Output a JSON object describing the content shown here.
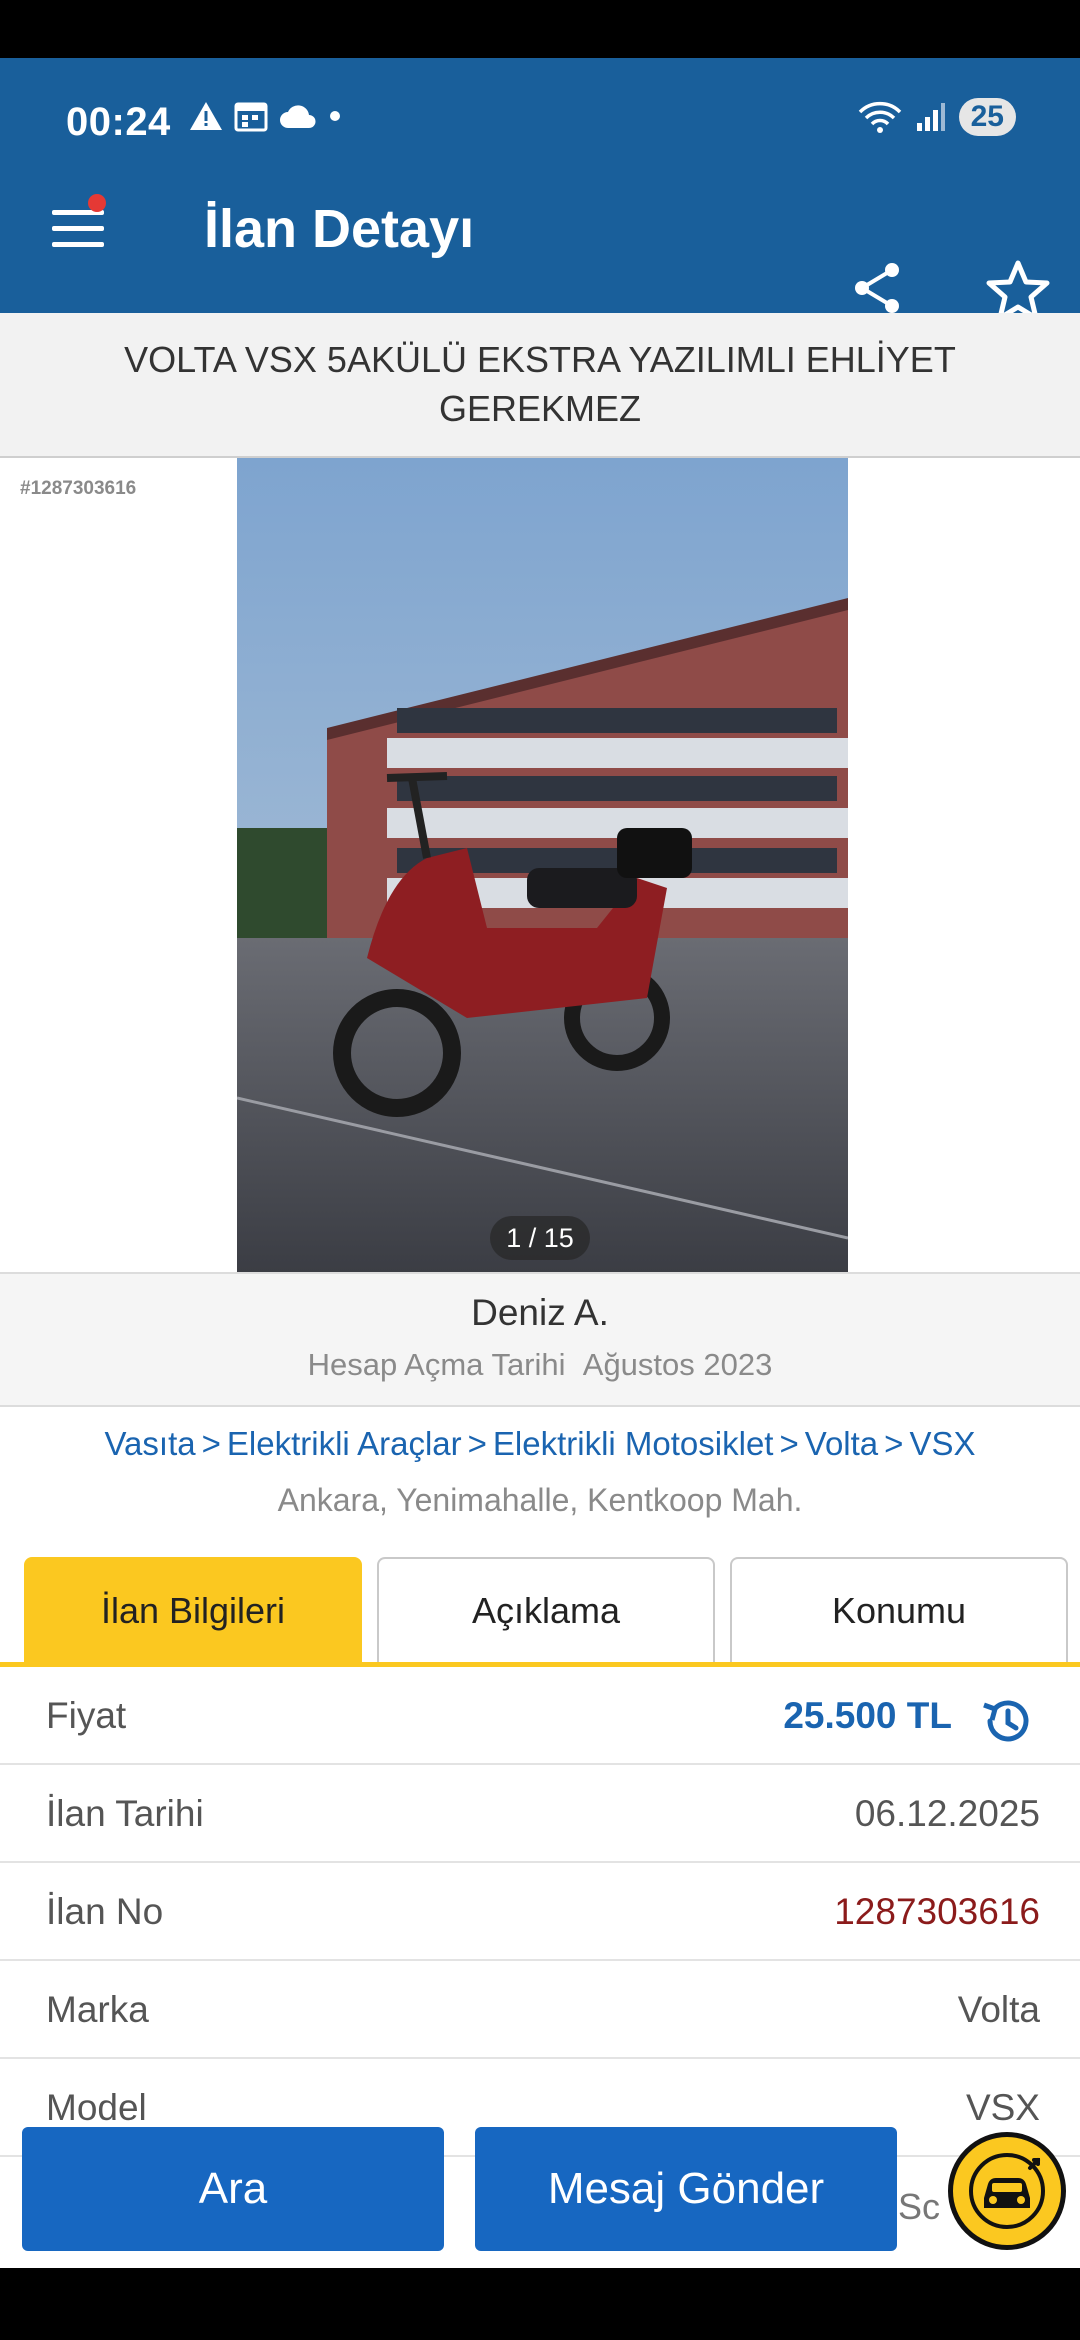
{
  "status_bar": {
    "time": "00:24",
    "battery": "25"
  },
  "header": {
    "title": "İlan Detayı"
  },
  "listing": {
    "title": "VOLTA VSX 5AKÜLÜ EKSTRA YAZILIMLI EHLİYET GEREKMEZ",
    "listing_tag": "#1287303616",
    "photo_counter": "1 / 15"
  },
  "seller": {
    "name": "Deniz A.",
    "since_label": "Hesap Açma Tarihi",
    "since_value": "Ağustos 2023"
  },
  "breadcrumb": {
    "items": [
      "Vasıta",
      "Elektrikli Araçlar",
      "Elektrikli Motosiklet",
      "Volta",
      "VSX"
    ],
    "separator": ">"
  },
  "location": "Ankara, Yenimahalle, Kentkoop Mah.",
  "tabs": [
    {
      "label": "İlan Bilgileri",
      "active": true
    },
    {
      "label": "Açıklama",
      "active": false
    },
    {
      "label": "Konumu",
      "active": false
    }
  ],
  "info": [
    {
      "key": "Fiyat",
      "value": "25.500 TL"
    },
    {
      "key": "İlan Tarihi",
      "value": "06.12.2025"
    },
    {
      "key": "İlan No",
      "value": "1287303616"
    },
    {
      "key": "Marka",
      "value": "Volta"
    },
    {
      "key": "Model",
      "value": "VSX"
    }
  ],
  "partial_row_text": "Sc",
  "actions": {
    "call_label": "Ara",
    "message_label": "Mesaj Gönder"
  },
  "icons": [
    "menu-icon",
    "share-icon",
    "star-icon",
    "history-icon",
    "car-icon",
    "warning-icon",
    "calendar-icon",
    "cloud-icon",
    "wifi-icon",
    "signal-icon"
  ],
  "colors": {
    "primary": "#195f9b",
    "accent": "#fbc820",
    "button": "#1767c1",
    "listing_no": "#8b1b1b"
  }
}
